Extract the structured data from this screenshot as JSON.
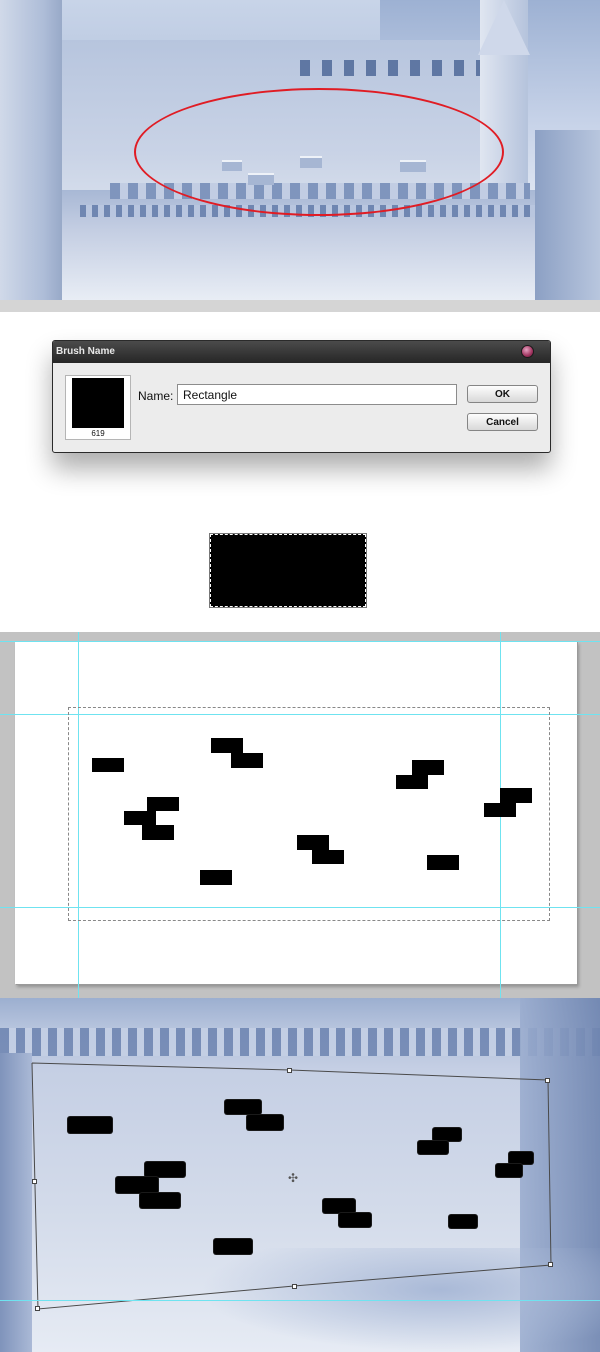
{
  "dialog": {
    "title": "Brush Name",
    "brush_size": "619",
    "name_label": "Name:",
    "name_value": "Rectangle",
    "ok_label": "OK",
    "cancel_label": "Cancel"
  },
  "icons": {
    "close": "close-icon",
    "crosshair": "crosshair-icon"
  },
  "colors": {
    "highlight_ellipse": "#e01c24",
    "guide": "#6fe3f0",
    "brush": "#000000"
  }
}
